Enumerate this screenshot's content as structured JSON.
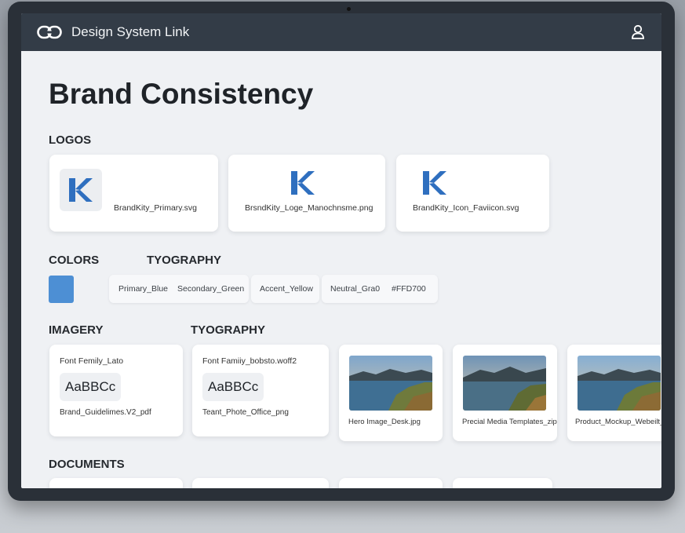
{
  "app": {
    "title": "Design System Link"
  },
  "page": {
    "title": "Brand Consistency"
  },
  "sections": {
    "logos": "LOGOS",
    "colors": "COLORS",
    "typography_1": "TYOGRAPHY",
    "imagery": "IMAGERY",
    "typography_2": "TYOGRAPHY",
    "documents": "DOCUMENTS"
  },
  "logos": [
    {
      "name": "BrandKity_Primary.svg"
    },
    {
      "name": "BrsndKity_Loge_Manochnsme.png"
    },
    {
      "name": "BrandKity_Icon_Faviicon.svg"
    }
  ],
  "colors": {
    "swatch_color": "#4d8fd4",
    "chips": [
      {
        "a": "Primary_Blue",
        "b": "Secondary_Green"
      },
      {
        "a": "Accent_Yellow"
      },
      {
        "a": "Neutral_Gra0",
        "b": "#FFD700"
      }
    ]
  },
  "fonts": [
    {
      "label": "Font Femily_Lato",
      "sample": "AaBBCc",
      "file": "Brand_Guidelimes.V2_pdf"
    },
    {
      "label": "Font Famiiy_bobsto.woff2",
      "sample": "AaBBCc",
      "file": "Teant_Phote_Office_png"
    }
  ],
  "images": [
    {
      "caption": "Hero Image_Desk.jpg"
    },
    {
      "caption": "Precial Media Templates_zip"
    },
    {
      "caption": "Product_Mockup_Webeilt_"
    }
  ],
  "colors_accent": {
    "brand_blue": "#2f6fbf",
    "topbar": "#333c47"
  }
}
